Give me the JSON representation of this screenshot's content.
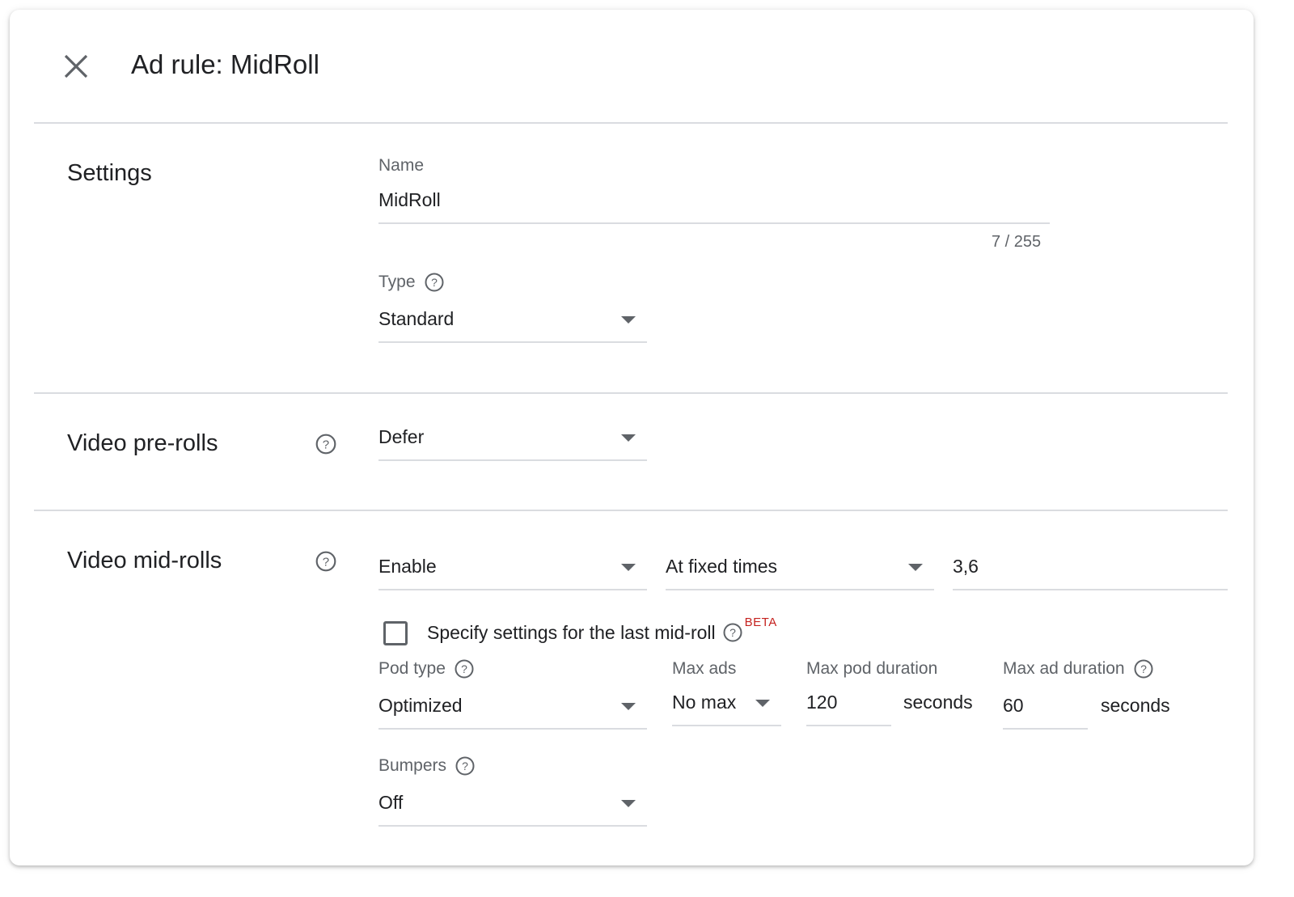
{
  "header": {
    "title": "Ad rule: MidRoll",
    "close_icon": "close-icon"
  },
  "settings": {
    "section_title": "Settings",
    "name": {
      "label": "Name",
      "value": "MidRoll",
      "counter": "7 / 255"
    },
    "type": {
      "label": "Type",
      "value": "Standard",
      "help_icon": "help-icon"
    }
  },
  "preroll": {
    "section_title": "Video pre-rolls",
    "help_icon": "help-icon",
    "mode": "Defer"
  },
  "midroll": {
    "section_title": "Video mid-rolls",
    "help_icon": "help-icon",
    "mode": "Enable",
    "timing": "At fixed times",
    "times": "3,6",
    "last_midroll": {
      "label": "Specify settings for the last mid-roll",
      "checked": false,
      "badge": "BETA"
    },
    "pod_type": {
      "label": "Pod type",
      "value": "Optimized"
    },
    "max_ads": {
      "label": "Max ads",
      "value": "No max"
    },
    "max_pod_duration": {
      "label": "Max pod duration",
      "value": "120",
      "unit": "seconds"
    },
    "max_ad_duration": {
      "label": "Max ad duration",
      "value": "60",
      "unit": "seconds"
    },
    "bumpers": {
      "label": "Bumpers",
      "value": "Off"
    }
  },
  "colors": {
    "text_primary": "#202124",
    "text_secondary": "#5f6368",
    "divider": "#dadce0",
    "beta_badge": "#c5221f"
  }
}
